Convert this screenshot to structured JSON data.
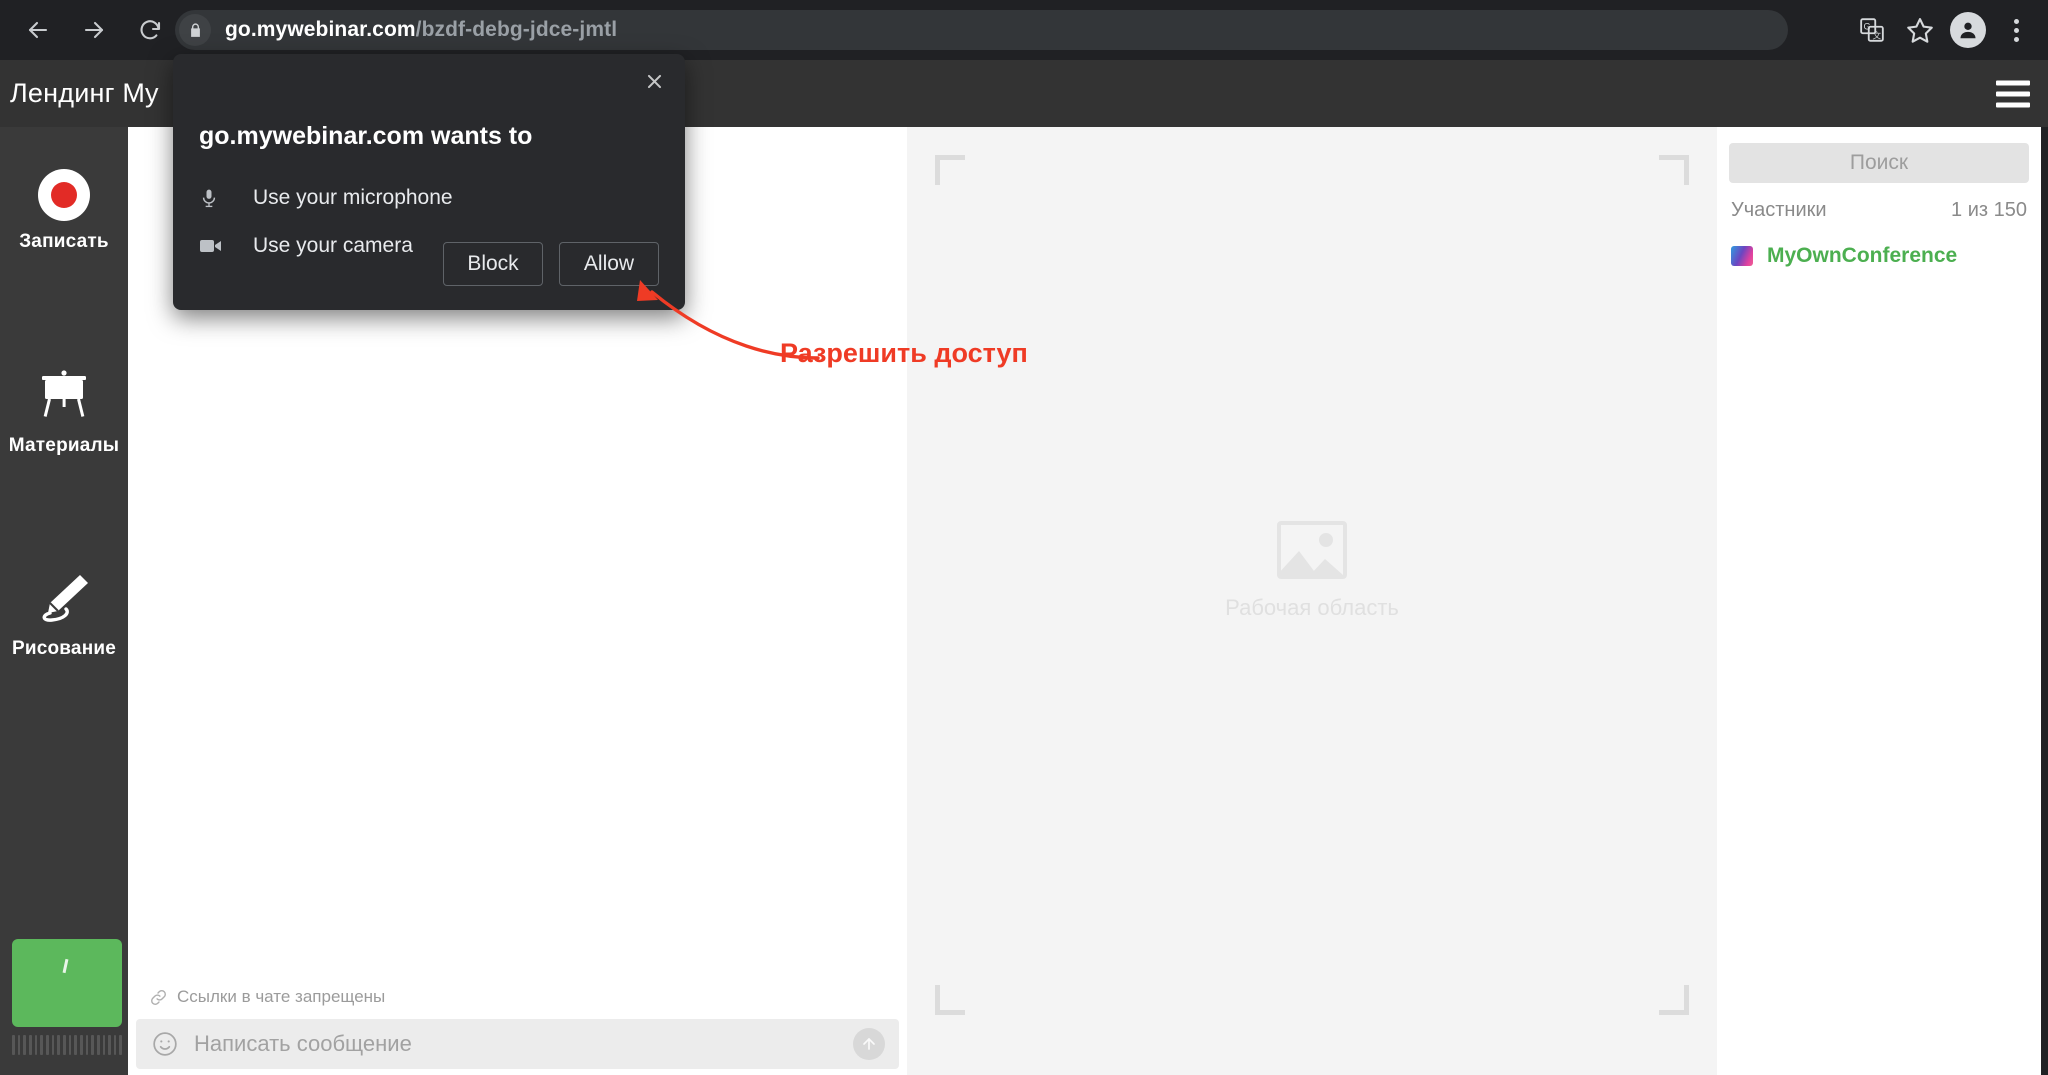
{
  "browser": {
    "back_label": "Back",
    "forward_label": "Forward",
    "reload_label": "Reload",
    "url_host": "go.mywebinar.com",
    "url_path": "/bzdf-debg-jdce-jmtl",
    "lock_icon": "lock-icon",
    "translate_icon": "translate-icon",
    "bookmark_icon": "star-icon",
    "profile_icon": "profile-avatar-icon",
    "menu_icon": "three-dots-menu-icon"
  },
  "app_header": {
    "title": "Лендинг My",
    "menu_label": "Меню"
  },
  "left_rail": {
    "items": [
      {
        "label": "Записать",
        "icon": "record-icon"
      },
      {
        "label": "Материалы",
        "icon": "presentation-board-icon"
      },
      {
        "label": "Рисование",
        "icon": "pencil-icon"
      }
    ],
    "selfview_color": "#5cb85c"
  },
  "chat": {
    "notice": "Ссылки в чате запрещены",
    "notice_icon": "link-icon",
    "emoji_icon": "smiley-icon",
    "input_placeholder": "Написать сообщение",
    "send_icon": "send-arrow-up-icon"
  },
  "workspace": {
    "placeholder_label": "Рабочая область",
    "placeholder_icon": "image-placeholder-icon"
  },
  "participants": {
    "search_placeholder": "Поиск",
    "section_label": "Участники",
    "count_label": "1 из 150",
    "list": [
      {
        "name": "MyOwnConference",
        "avatar": "myownconference-logo-icon",
        "color": "#4caf50"
      }
    ]
  },
  "permission_dialog": {
    "title": "go.mywebinar.com wants to",
    "close_label": "✕",
    "permissions": [
      {
        "label": "Use your microphone",
        "icon": "microphone-icon"
      },
      {
        "label": "Use your camera",
        "icon": "camera-icon"
      }
    ],
    "block_label": "Block",
    "allow_label": "Allow"
  },
  "annotation": {
    "text": "Разрешить доступ",
    "color": "#ef3b25"
  }
}
